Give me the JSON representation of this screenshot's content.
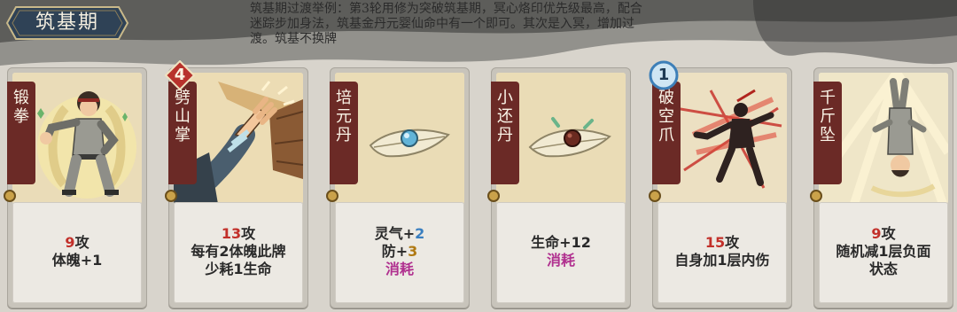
{
  "stage": {
    "label": "筑基期"
  },
  "hint": {
    "lines": [
      "筑基期过渡举例：第3轮用修为突破筑基期，冥心烙印优先级最高，配合",
      "迷踪步加身法，筑基金丹元婴仙命中有一个即可。其次是入冥，增加过",
      "渡。筑基不换牌"
    ]
  },
  "cards": [
    {
      "name": "锻拳",
      "art": "fist-fighter-icon",
      "desc": {
        "a_num": "9",
        "a_txt": "攻",
        "b": "体魄+1"
      }
    },
    {
      "name": "劈山掌",
      "art": "palm-strike-icon",
      "badge": {
        "value": "4",
        "color": "#b8322c"
      },
      "desc": {
        "a_num": "13",
        "a_txt": "攻",
        "b": "每有2体魄此牌",
        "c": "少耗1生命"
      }
    },
    {
      "name": "培元丹",
      "art": "pill-on-leaf-icon",
      "desc": {
        "a_txt": "灵气+",
        "a_num": "2",
        "b_txt": "防+",
        "b_num": "3",
        "c": "消耗"
      }
    },
    {
      "name": "小还丹",
      "art": "dark-pill-on-leaf-icon",
      "desc": {
        "a": "生命+12",
        "b": "消耗"
      }
    },
    {
      "name": "破空爪",
      "art": "shadow-claw-icon",
      "badge": {
        "value": "1",
        "color": "#3d7fb8"
      },
      "desc": {
        "a_num": "15",
        "a_txt": "攻",
        "b": "自身加1层内伤"
      }
    },
    {
      "name": "千斤坠",
      "art": "inverted-fall-icon",
      "desc": {
        "a_num": "9",
        "a_txt": "攻",
        "b": "随机减1层负面",
        "c": "状态"
      }
    }
  ],
  "colors": {
    "attack": "#c2302a",
    "qi": "#3a7fc0",
    "defense": "#b07a14",
    "consume": "#b0308f",
    "banner": "#6b2a26"
  }
}
